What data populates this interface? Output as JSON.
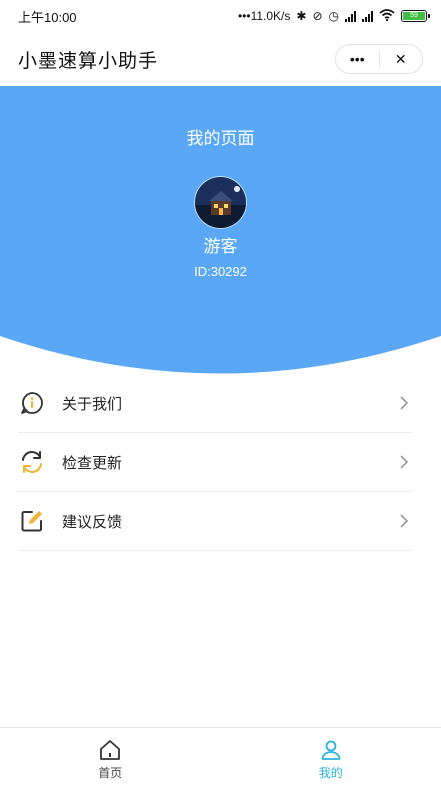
{
  "status_bar": {
    "time": "上午10:00",
    "net_speed": "•••11.0K/s",
    "battery": "59"
  },
  "header": {
    "title": "小墨速算小助手",
    "more_label": "•••",
    "close_label": "✕"
  },
  "profile": {
    "page_title": "我的页面",
    "username": "游客",
    "user_id": "ID:30292"
  },
  "menu": {
    "items": [
      {
        "label": "关于我们",
        "icon": "info-icon"
      },
      {
        "label": "检查更新",
        "icon": "refresh-icon"
      },
      {
        "label": "建议反馈",
        "icon": "edit-icon"
      }
    ]
  },
  "tabs": [
    {
      "label": "首页",
      "icon": "home-icon",
      "active": false
    },
    {
      "label": "我的",
      "icon": "user-icon",
      "active": true
    }
  ],
  "colors": {
    "hero_blue": "#5aa8f5",
    "active_tab": "#2ab3e0",
    "icon_accent": "#f2b233"
  }
}
